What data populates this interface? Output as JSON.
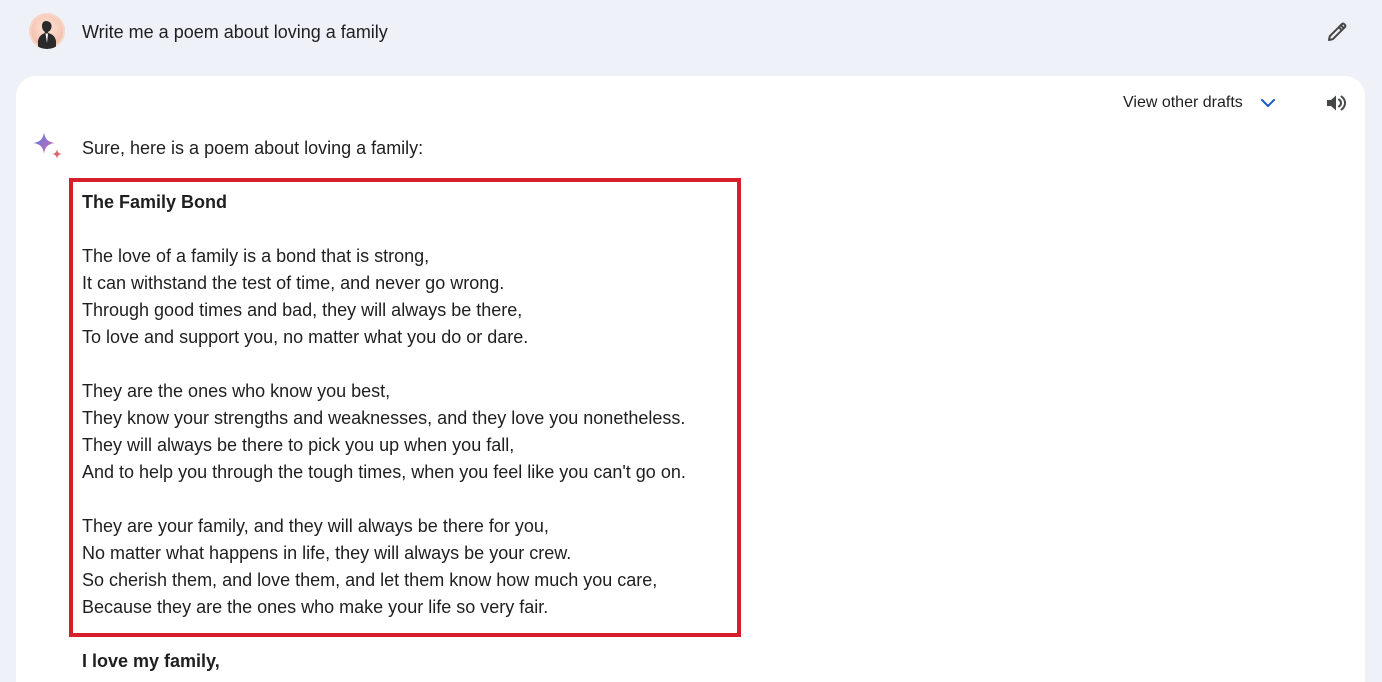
{
  "prompt": {
    "text": "Write me a poem about loving a family"
  },
  "icons": {
    "avatar": "user-avatar",
    "edit": "pencil-icon",
    "drafts_chevron": "chevron-down-icon",
    "speaker": "speaker-icon",
    "assistant": "sparkle-icon"
  },
  "colors": {
    "page_background": "#eef1f8",
    "card_background": "#ffffff",
    "highlight_border": "#d71f2b",
    "chevron": "#1a5cc8"
  },
  "response": {
    "drafts_label": "View other drafts",
    "intro": "Sure, here is a poem about loving a family:",
    "poem": {
      "title": "The Family Bond",
      "stanzas": [
        {
          "lines": [
            "The love of a family is a bond that is strong,",
            "It can withstand the test of time, and never go wrong.",
            "Through good times and bad, they will always be there,",
            "To love and support you, no matter what you do or dare."
          ]
        },
        {
          "lines": [
            "They are the ones who know you best,",
            "They know your strengths and weaknesses, and they love you nonetheless.",
            "They will always be there to pick you up when you fall,",
            "And to help you through the tough times, when you feel like you can't go on."
          ]
        },
        {
          "lines": [
            "They are your family, and they will always be there for you,",
            "No matter what happens in life, they will always be your crew.",
            "So cherish them, and love them, and let them know how much you care,",
            "Because they are the ones who make your life so very fair."
          ]
        }
      ]
    },
    "closing": "I love my family,"
  }
}
